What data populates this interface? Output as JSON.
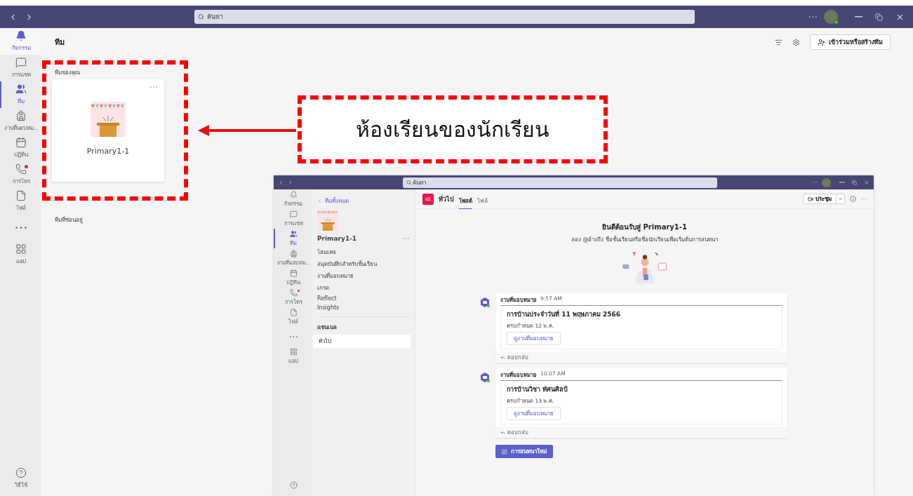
{
  "title_bar": {
    "search": {
      "placeholder": "ค้นหา"
    }
  },
  "rail": {
    "items": [
      {
        "label": "กิจกรรม",
        "selected": false,
        "hovered": true,
        "notification": false
      },
      {
        "label": "การแชท",
        "selected": false,
        "hovered": false,
        "notification": false
      },
      {
        "label": "ทีม",
        "selected": true,
        "hovered": false,
        "notification": false
      },
      {
        "label": "งานที่มอบหม...",
        "selected": false,
        "hovered": false,
        "notification": false
      },
      {
        "label": "ปฏิทิน",
        "selected": false,
        "hovered": false,
        "notification": false
      },
      {
        "label": "การโทร",
        "selected": false,
        "hovered": false,
        "notification": true
      },
      {
        "label": "ไฟล์",
        "selected": false,
        "hovered": false,
        "notification": false
      },
      {
        "selected": false,
        "hovered": false,
        "notification": false
      },
      {
        "label": "แอป",
        "selected": false,
        "hovered": false,
        "notification": false
      }
    ],
    "help": "วิธีใช้"
  },
  "page": {
    "title": "ทีม",
    "join_button": "เข้าร่วมหรือสร้างทีม",
    "section": "ทีมของคุณ",
    "teams": [
      {
        "name": "Primary1-1"
      }
    ],
    "hidden_section": "ทีมที่ซ่อนอยู่"
  },
  "annotation": {
    "callout": "ห้องเรียนของนักเรียน"
  },
  "inset": {
    "search": {
      "placeholder": "ค้นหา"
    },
    "rail": {
      "items": [
        {
          "label": "กิจกรรม",
          "selected": false,
          "hovered": false,
          "notification": false
        },
        {
          "label": "การแชท",
          "selected": false,
          "hovered": false,
          "notification": false
        },
        {
          "label": "ทีม",
          "selected": true,
          "hovered": false,
          "notification": false
        },
        {
          "label": "งานที่มอบหม...",
          "selected": false,
          "hovered": false,
          "notification": false
        },
        {
          "label": "ปฏิทิน",
          "selected": false,
          "hovered": false,
          "notification": false
        },
        {
          "label": "การโทร",
          "selected": false,
          "hovered": false,
          "notification": true
        },
        {
          "label": "ไฟล์",
          "selected": false,
          "hovered": false,
          "notification": false
        },
        {
          "selected": false,
          "hovered": false,
          "notification": false
        },
        {
          "label": "แอป",
          "selected": false,
          "hovered": false,
          "notification": false
        }
      ]
    },
    "sidebar": {
      "back": "ทีมทั้งหมด",
      "team": "Primary1-1",
      "items": [
        "โฮมเพจ",
        "สมุดบันทึกสำหรับชั้นเรียน",
        "งานที่มอบหมาย",
        "เกรด",
        "Reflect",
        "Insights"
      ],
      "channels_heading": "แชนเนล",
      "channels": [
        {
          "name": "ทั่วไป",
          "selected": true
        }
      ]
    },
    "channel": {
      "avatar": "ป1",
      "name": "ทั่วไป",
      "tabs": [
        {
          "label": "โพสต์",
          "selected": true
        },
        {
          "label": "ไฟล์",
          "selected": false
        }
      ],
      "meet_button": "ประชุม"
    },
    "welcome": {
      "title": "ยินดีต้อนรับสู่ Primary1-1",
      "hint": "ลอง @อ้างถึง ชื่อชั้นเรียนหรือชื่อนักเรียนเพื่อเริ่มต้นการสนทนา"
    },
    "posts": [
      {
        "author": "งานที่มอบหมาย",
        "time": "9:57 AM",
        "title": "การบ้านประจำวันที่ 11 พฤษภาคม 2566",
        "due": "ครบกำหนด 12 พ.ค.",
        "button": "ดูงานที่มอบหมาย",
        "reply": "ตอบกลับ"
      },
      {
        "author": "งานที่มอบหมาย",
        "time": "10:07 AM",
        "title": "การบ้านวิชา ทัศนศิลป์",
        "due": "ครบกำหนด 13 พ.ค.",
        "button": "ดูงานที่มอบหมาย",
        "reply": "ตอบกลับ"
      }
    ],
    "new_conversation": "การสนทนาใหม่"
  }
}
